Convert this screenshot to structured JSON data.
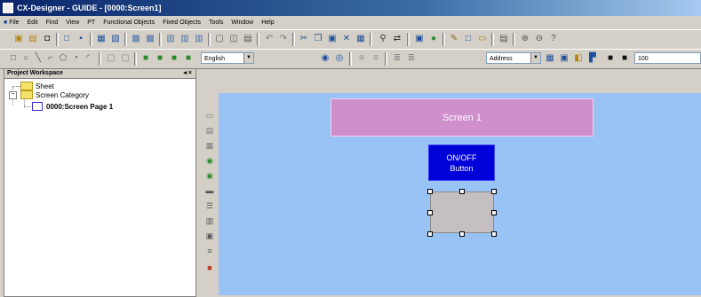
{
  "window": {
    "title": "CX-Designer - GUIDE - [0000:Screen1]"
  },
  "menubar": {
    "items": [
      "File",
      "Edit",
      "Find",
      "View",
      "PT",
      "Functional Objects",
      "Fixed Objects",
      "Tools",
      "Window",
      "Help"
    ]
  },
  "toolbar": {
    "language_select": {
      "value": "English"
    },
    "address_select": {
      "value": "Address"
    },
    "zoom_value": "100"
  },
  "workspace": {
    "title": "Project Workspace",
    "tree": [
      {
        "label": "Sheet"
      },
      {
        "label": "Screen Category"
      },
      {
        "label": "0000:Screen Page 1"
      }
    ]
  },
  "canvas": {
    "screen_label": "Screen 1",
    "onoff_button": {
      "line1": "ON/OFF",
      "line2": "Button"
    }
  },
  "colors": {
    "canvas_bg": "#99c2f5",
    "label_bg": "#cf8fcc",
    "button_bg": "#0000d8",
    "lamp_bg": "#c6bfc2"
  }
}
